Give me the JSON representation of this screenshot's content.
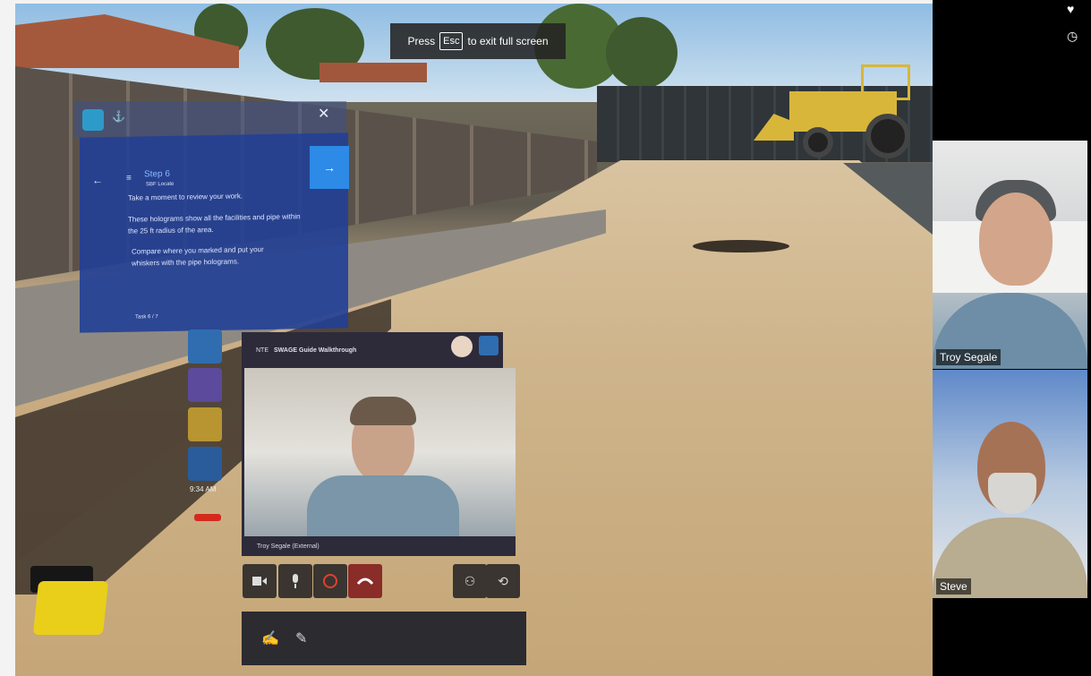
{
  "toast": {
    "before": "Press",
    "key": "Esc",
    "after": "to exit full screen"
  },
  "step_panel": {
    "title": "Step 6",
    "subtitle": "SBF Locate",
    "line1": "Take a moment to review your work.",
    "line2": "These holograms show all the facilities and pipe within the 25 ft radius of the area.",
    "line3": "Compare where you marked and put your whiskers with the pipe holograms.",
    "footer": "Task 6 / 7"
  },
  "app_bar": {
    "time": "9:34 AM"
  },
  "call_window": {
    "title": "SWAGE Guide Walkthrough",
    "prefix": "NTE",
    "caption": "Troy Segale (External)"
  },
  "participants": [
    {
      "name": "Troy Segale"
    },
    {
      "name": "Steve"
    }
  ],
  "icons": {
    "heart": "heart-icon",
    "clock": "clock-icon",
    "video": "video-icon",
    "mic": "mic-icon",
    "record": "record-icon",
    "hangup": "hangup-icon",
    "participants": "people-icon",
    "share": "share-icon",
    "close": "close-icon",
    "next": "arrow-right-icon",
    "back": "arrow-left-icon"
  },
  "colors": {
    "hologram_blue": "#21409a",
    "accent_blue": "#2d8ae6",
    "hangup_red": "#8a2c28",
    "sidebar_bg": "#000000"
  }
}
